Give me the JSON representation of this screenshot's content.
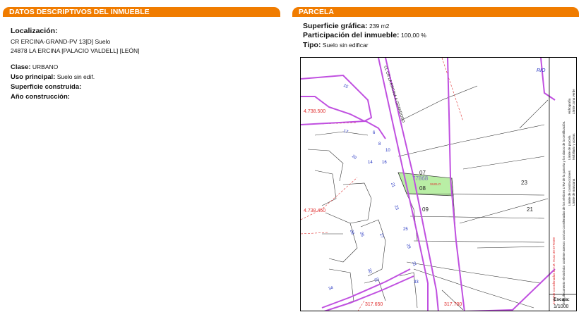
{
  "left_panel": {
    "header_prefix": "DATOS DESCRIPTIVOS DEL",
    "header_highlight": "INMUEBLE",
    "localizacion_label": "Localización:",
    "address_line1": "CR ERCINA-GRAND-PV 13[D] Suelo",
    "address_line2": "24878 LA ERCINA [PALACIO VALDELL] [LEÓN]",
    "clase_label": "Clase:",
    "clase_value": "URBANO",
    "uso_label": "Uso principal:",
    "uso_value": "Suelo sin edif.",
    "superficie_label": "Superficie construida:",
    "anio_label": "Año construcción:"
  },
  "right_panel": {
    "header": "PARCELA",
    "superficie_label": "Superficie gráfica:",
    "superficie_value": "239 m2",
    "participacion_label": "Participación del inmueble:",
    "participacion_value": "100,00 %",
    "tipo_label": "Tipo:",
    "tipo_value": "Suelo sin edificar"
  },
  "map": {
    "coord_y1": "4.738.500",
    "coord_y2": "4.738.450",
    "coord_x1": "317.650",
    "coord_x2": "317.700",
    "road_label": "CL CR LA ERCINA A GRANDOSO",
    "river_label": "RIO",
    "parcel_07": "07",
    "parcel_08": "08",
    "parcel_09": "09",
    "parcel_23": "23",
    "parcel_21": "21",
    "plot_ref": "77868",
    "suelo_tag": "SUELO",
    "legend_lines": [
      "Límite de parcela",
      "Límite de construcciones",
      "Límite de manzana",
      "Hidrografía",
      "Límite zona verde",
      "Mobiliario y aceras"
    ],
    "legend_note": "Este documento electrónico contiene anexos con las coordenadas de los vértices UTM de la parcela y los datos de la certificación.",
    "legend_coords": "317.700 Coordenadas U.T.M. Huso 30 ETRS89",
    "scale_label": "Escala:",
    "scale_value": "1/1000"
  },
  "colors": {
    "header_bg": "#f07c00",
    "parcel_fill": "#b9eea5",
    "road_line": "#c050e0",
    "coord_text": "#e03030",
    "house_number": "#2030c0"
  }
}
